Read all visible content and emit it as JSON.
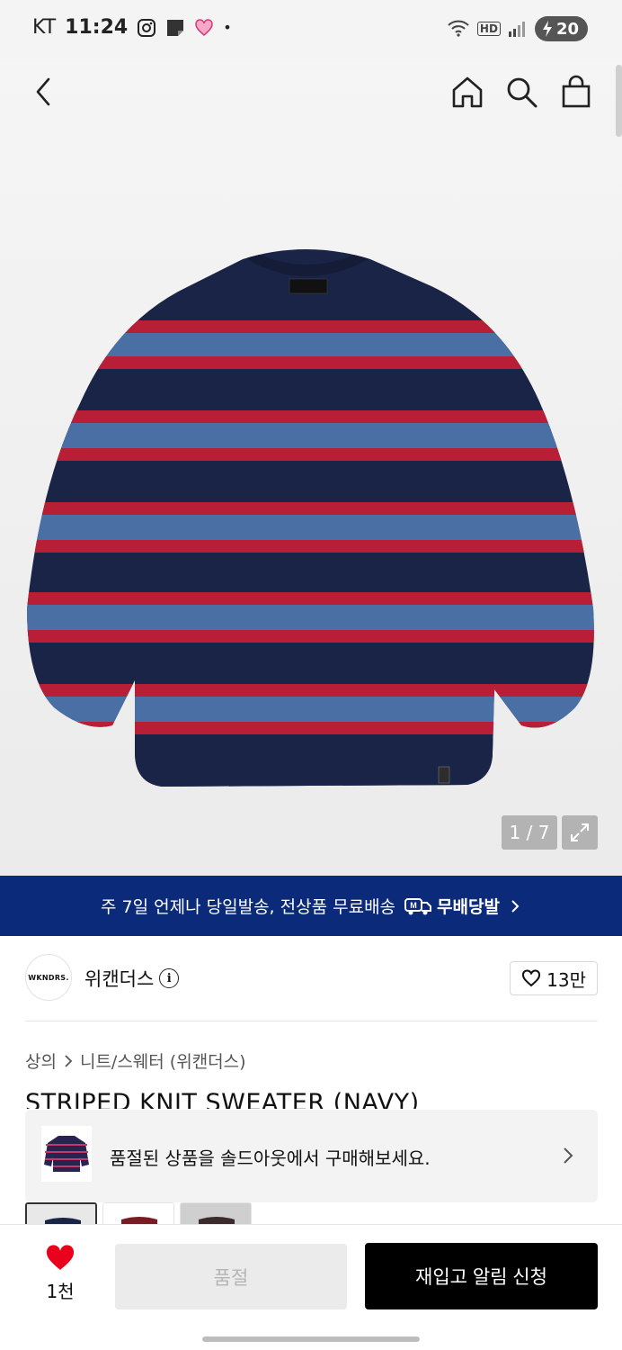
{
  "status_bar": {
    "carrier": "KT",
    "time": "11:24",
    "network_badge": "HD",
    "battery": "20"
  },
  "image_viewer": {
    "counter": "1 / 7"
  },
  "promo_banner": {
    "text": "주 7일 언제나 당일발송, 전상품 무료배송",
    "brand_label": "무배당발",
    "brand_mark": "M"
  },
  "brand": {
    "logo_text": "WKNDRS.",
    "name": "위캔더스",
    "likes": "13만"
  },
  "breadcrumb": {
    "category": "상의",
    "subcategory": "니트/스웨터 (위캔더스)"
  },
  "product": {
    "title": "STRIPED KNIT SWEATER (NAVY)"
  },
  "soldout_notice": {
    "text": "품절된 상품을 솔드아웃에서 구매해보세요."
  },
  "bottom_bar": {
    "like_count": "1천",
    "soldout_label": "품절",
    "restock_label": "재입고 알림 신청"
  },
  "colors": {
    "promo_bg": "#0b2a7a",
    "navy": "#1a2447",
    "stripe_blue": "#4a6fa5",
    "stripe_red": "#b81e35",
    "like_red": "#e8001c"
  }
}
